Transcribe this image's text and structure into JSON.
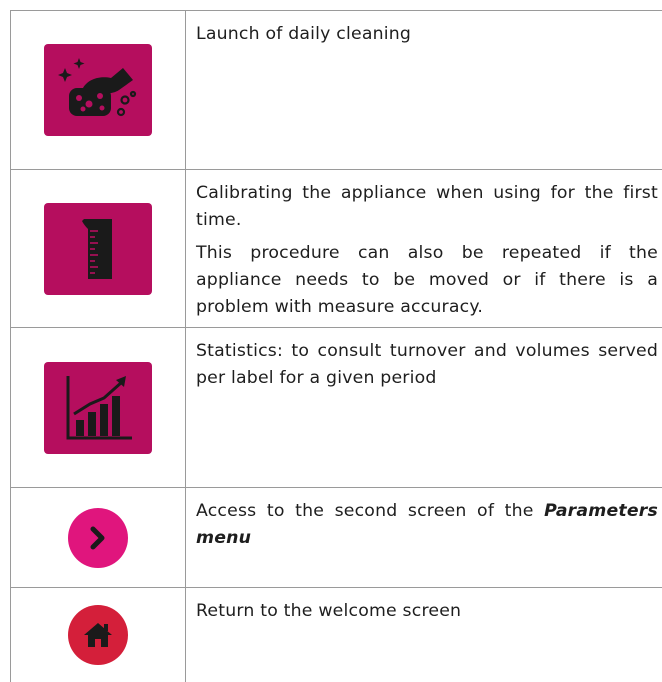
{
  "colors": {
    "icon_square": "#b50e5e",
    "next_circle": "#e0157d",
    "home_circle": "#d41f3a",
    "border": "#9a9a9a"
  },
  "rows": [
    {
      "icon": "cleaning-icon",
      "text": "Launch of daily cleaning"
    },
    {
      "icon": "measuring-cup-icon",
      "text": "Calibrating the appliance when using for the first time.",
      "text2": "This procedure can also be repeated if the appliance needs to be moved or if there is a problem with measure accuracy."
    },
    {
      "icon": "statistics-chart-icon",
      "text": "Statistics: to consult turnover and volumes served per label for a given period"
    },
    {
      "icon": "chevron-right-icon",
      "text_prefix": "Access to the second screen of the ",
      "text_emphasis": "Parameters menu"
    },
    {
      "icon": "home-icon",
      "text": "Return to the welcome screen"
    }
  ]
}
